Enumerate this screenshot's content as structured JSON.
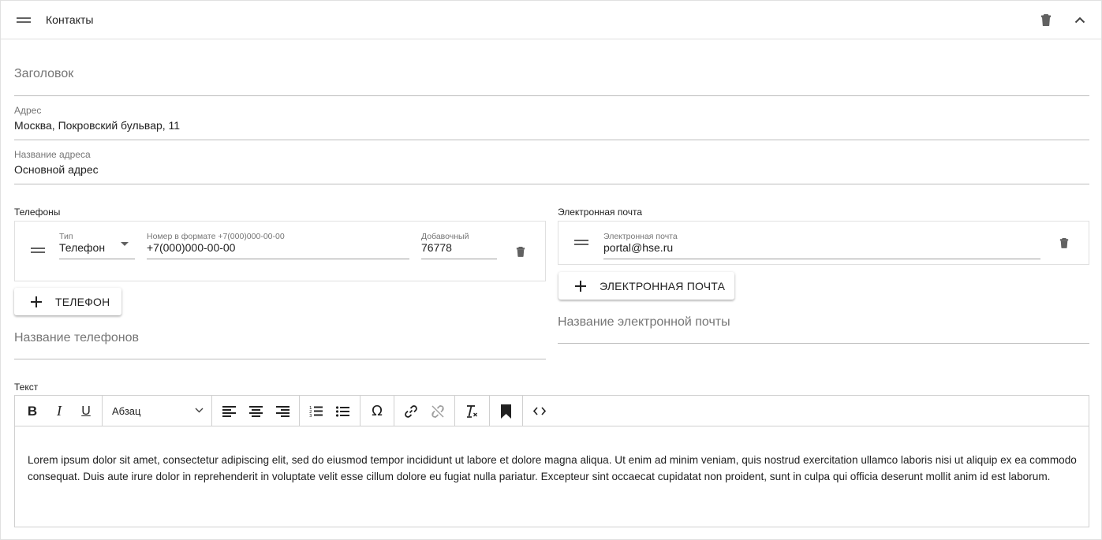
{
  "header": {
    "title": "Контакты",
    "drag_icon": "drag-handle-icon",
    "delete_icon": "trash-icon",
    "collapse_icon": "chevron-up-icon"
  },
  "form": {
    "heading": {
      "placeholder": "Заголовок"
    },
    "address": {
      "label": "Адрес",
      "value": "Москва, Покровский бульвар, 11"
    },
    "address_name": {
      "label": "Название адреса",
      "value": "Основной адрес"
    }
  },
  "phones": {
    "section_label": "Телефоны",
    "items": [
      {
        "type_label": "Тип",
        "type_value": "Телефон",
        "number_label": "Номер в формате +7(000)000-00-00",
        "number_value": "+7(000)000-00-00",
        "ext_label": "Добавочный",
        "ext_value": "76778"
      }
    ],
    "add_button": "ТЕЛЕФОН",
    "name_placeholder": "Название телефонов"
  },
  "emails": {
    "section_label": "Электронная почта",
    "items": [
      {
        "label": "Электронная почта",
        "value": "portal@hse.ru"
      }
    ],
    "add_button": "ЭЛЕКТРОННАЯ ПОЧТА",
    "name_placeholder": "Название электронной почты"
  },
  "text_editor": {
    "section_label": "Текст",
    "toolbar": {
      "bold": "B",
      "italic": "I",
      "underline": "U",
      "format_selected": "Абзац",
      "special_char": "Ω"
    },
    "content": "Lorem ipsum dolor sit amet, consectetur adipiscing elit, sed do eiusmod tempor incididunt ut labore et dolore magna aliqua. Ut enim ad minim veniam, quis nostrud exercitation ullamco laboris nisi ut aliquip ex ea commodo consequat. Duis aute irure dolor in reprehenderit in voluptate velit esse cillum dolore eu fugiat nulla pariatur. Excepteur sint occaecat cupidatat non proident, sunt in culpa qui officia deserunt mollit anim id est laborum."
  },
  "colors": {
    "text": "#212121",
    "muted": "#757575",
    "border": "#e0e0e0",
    "icon": "#616161"
  }
}
